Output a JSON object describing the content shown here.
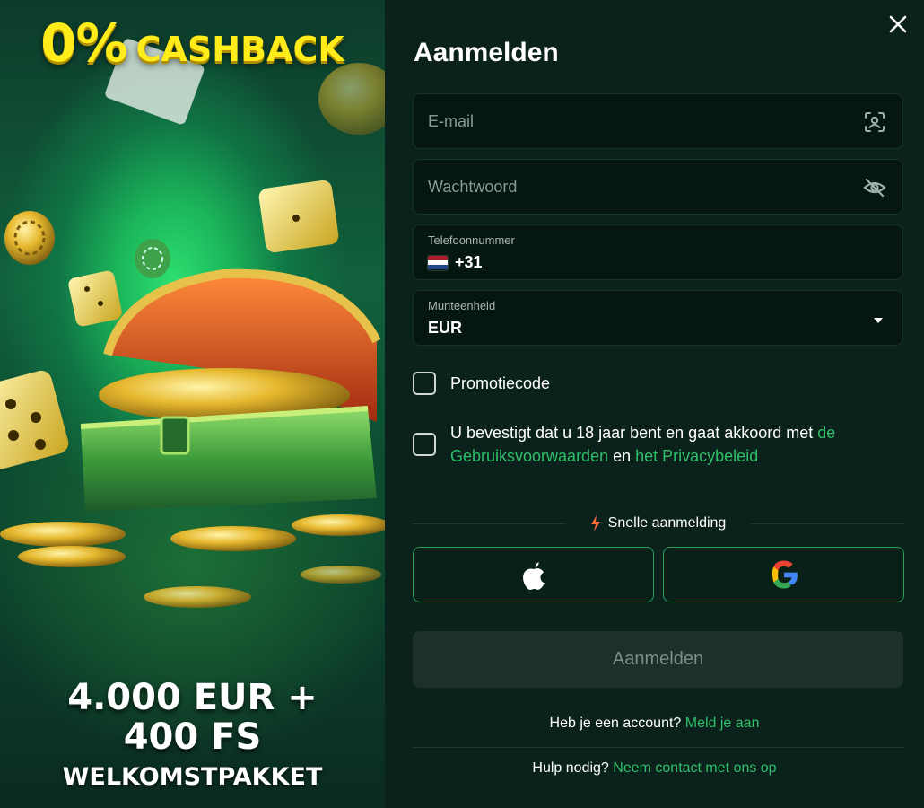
{
  "promo": {
    "headline_big": "0%",
    "headline_small": "CASHBACK",
    "amount": "4.000 EUR + 400 FS",
    "package": "WELKOMSTPAKKET"
  },
  "form": {
    "title": "Aanmelden",
    "email_placeholder": "E-mail",
    "password_placeholder": "Wachtwoord",
    "phone_label": "Telefoonnummer",
    "phone_prefix": "+31",
    "currency_label": "Munteenheid",
    "currency_value": "EUR",
    "promo_code_label": "Promotiecode",
    "terms_prefix": "U bevestigt dat u 18 jaar bent en gaat akkoord met ",
    "terms_link": "de Gebruiksvoorwaarden",
    "terms_and": " en ",
    "privacy_link": "het Privacybeleid",
    "quick_signup": "Snelle aanmelding",
    "submit_label": "Aanmelden",
    "have_account": "Heb je een account? ",
    "login_link": "Meld je aan",
    "need_help": "Hulp nodig? ",
    "contact_link": "Neem contact met ons op"
  },
  "icons": {
    "close": "close-icon",
    "email": "user-scan-icon",
    "password": "eye-off-icon",
    "currency": "caret-down-icon",
    "quick": "lightning-icon",
    "apple": "apple-icon",
    "google": "google-icon"
  },
  "colors": {
    "accent": "#2fbf6a",
    "headline_yellow": "#ffec1a",
    "panel_bg": "#0b211c",
    "field_bg": "#061712"
  }
}
